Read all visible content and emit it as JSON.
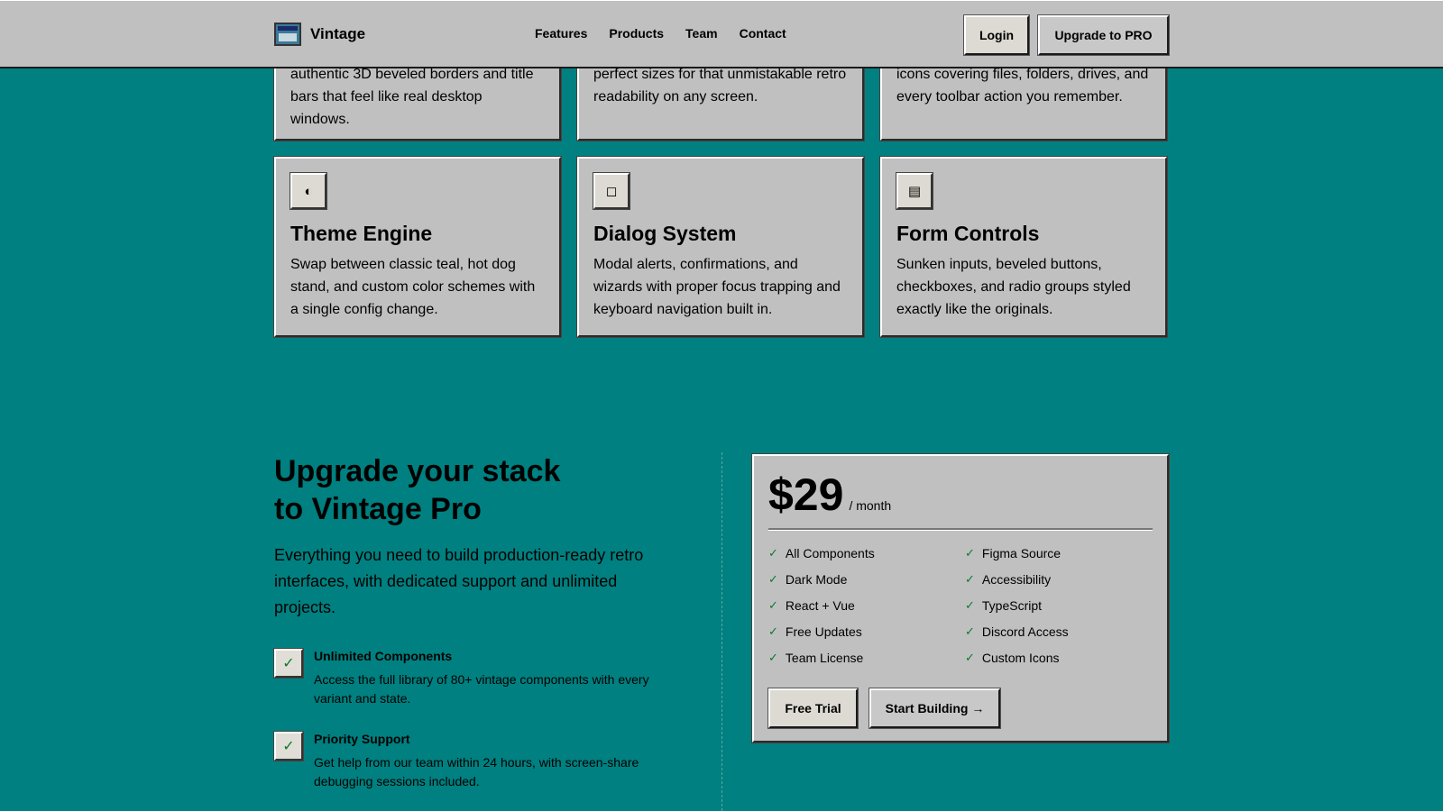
{
  "header": {
    "brand": "Vintage",
    "nav": [
      "Features",
      "Products",
      "Team",
      "Contact"
    ],
    "login_label": "Login",
    "upgrade_label": "Upgrade to PRO"
  },
  "features_top": [
    {
      "text": "authentic 3D beveled borders and title bars that feel like real desktop windows."
    },
    {
      "text": "perfect sizes for that unmistakable retro readability on any screen."
    },
    {
      "text": "icons covering files, folders, drives, and every toolbar action you remember."
    }
  ],
  "features": [
    {
      "icon": "◐",
      "icon_name": "contrast-icon",
      "title": "Theme Engine",
      "text": "Swap between classic teal, hot dog stand, and custom color schemes with a single config change."
    },
    {
      "icon": "◻",
      "icon_name": "window-icon",
      "title": "Dialog System",
      "text": "Modal alerts, confirmations, and wizards with proper focus trapping and keyboard navigation built in."
    },
    {
      "icon": "▤",
      "icon_name": "form-icon",
      "title": "Form Controls",
      "text": "Sunken inputs, beveled buttons, checkboxes, and radio groups styled exactly like the originals."
    }
  ],
  "upgrade": {
    "title_line1": "Upgrade your stack",
    "title_line2": "to Vintage Pro",
    "description": "Everything you need to build production-ready retro interfaces, with dedicated support and unlimited projects.",
    "benefits": [
      {
        "title": "Unlimited Components",
        "text": "Access the full library of 80+ vintage components with every variant and state."
      },
      {
        "title": "Priority Support",
        "text": "Get help from our team within 24 hours, with screen-share debugging sessions included."
      }
    ]
  },
  "pricing": {
    "amount": "$29",
    "period": "/ month",
    "features_left": [
      "All Components",
      "Dark Mode",
      "React + Vue",
      "Free Updates",
      "Team License"
    ],
    "features_right": [
      "Figma Source",
      "Accessibility",
      "TypeScript",
      "Discord Access",
      "Custom Icons"
    ],
    "trial_label": "Free Trial",
    "start_label": "Start Building →"
  },
  "colors": {
    "background": "#008080",
    "panel": "#c0c0c0",
    "check": "#0a7a2a"
  }
}
